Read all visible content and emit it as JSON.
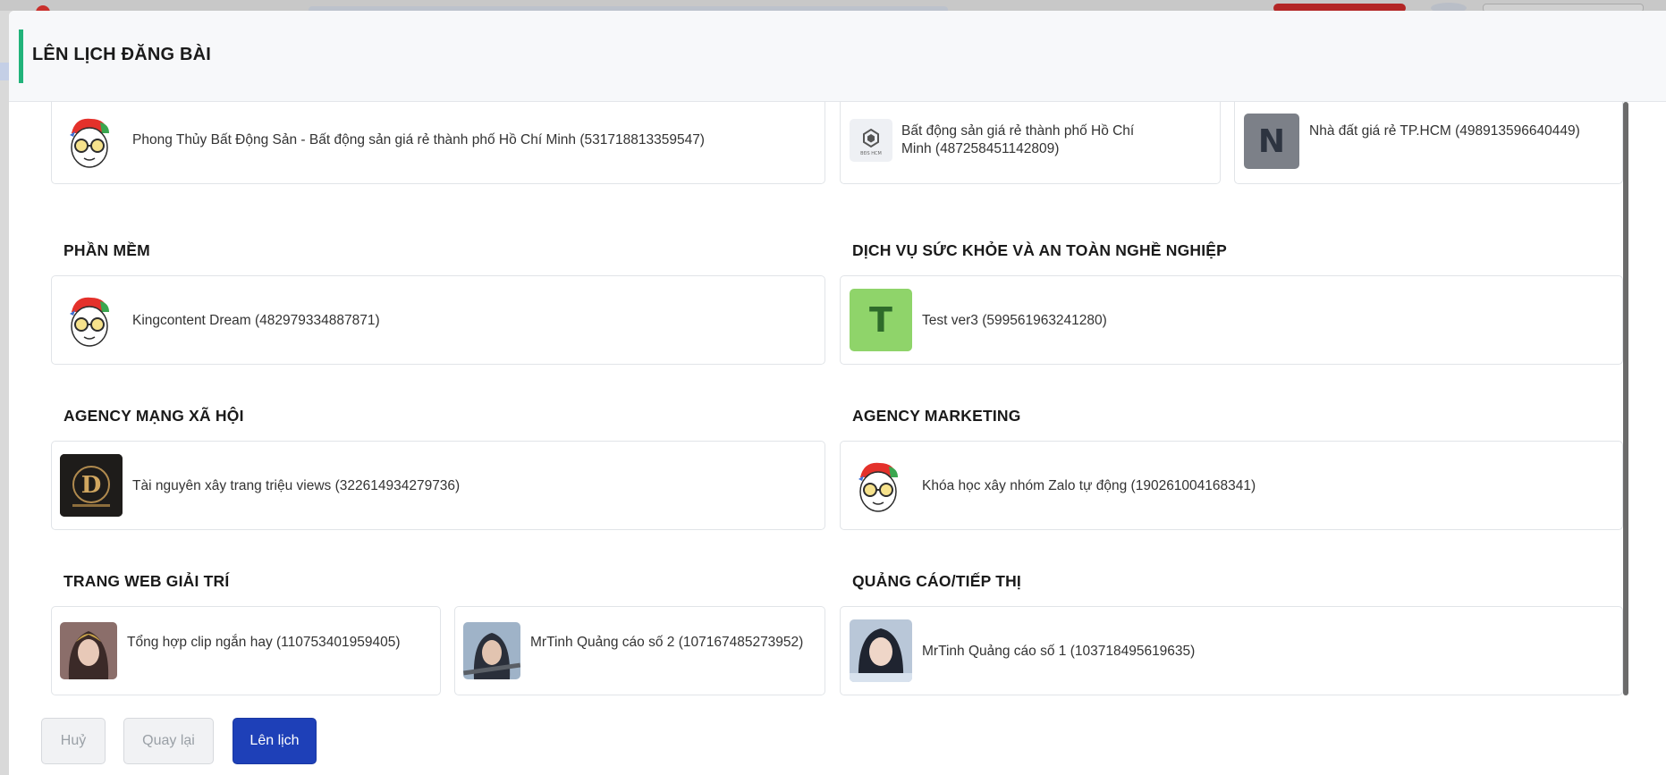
{
  "modal": {
    "title": "LÊN LỊCH ĐĂNG BÀI"
  },
  "top_row": [
    {
      "name": "Phong Thủy Bất Động Sản - Bất động sản giá rẻ thành phố Hồ Chí Minh (531718813359547)",
      "icon": "mascot-avatar-icon"
    },
    {
      "name": "Bất động sản giá rẻ thành phố Hồ Chí Minh (487258451142809)",
      "icon": "logo-avatar-icon",
      "logo_text": "BĐS HCM"
    },
    {
      "name": "Nhà đất giá rẻ TP.HCM (498913596640449)",
      "icon": "letter-avatar-icon",
      "letter": "N"
    }
  ],
  "sections": {
    "phan_mem": {
      "title": "PHẦN MỀM",
      "pages": [
        {
          "name": "Kingcontent Dream (482979334887871)",
          "icon": "mascot-avatar-icon"
        }
      ]
    },
    "dich_vu": {
      "title": "DỊCH VỤ SỨC KHỎE VÀ AN TOÀN NGHỀ NGHIỆP",
      "pages": [
        {
          "name": "Test ver3 (599561963241280)",
          "icon": "letter-avatar-icon",
          "letter": "T"
        }
      ]
    },
    "agency_mxh": {
      "title": "AGENCY MẠNG XÃ HỘI",
      "pages": [
        {
          "name": "Tài nguyên xây trang triệu views (322614934279736)",
          "icon": "d-logo-avatar-icon",
          "letter": "D"
        }
      ]
    },
    "agency_mkt": {
      "title": "AGENCY MARKETING",
      "pages": [
        {
          "name": "Khóa học xây nhóm Zalo tự động (190261004168341)",
          "icon": "mascot-avatar-icon"
        }
      ]
    },
    "giai_tri": {
      "title": "TRANG WEB GIẢI TRÍ",
      "pages": [
        {
          "name": "Tổng hợp clip ngắn hay (110753401959405)",
          "icon": "portrait-avatar-icon"
        },
        {
          "name": "MrTinh Quảng cáo số 2 (107167485273952)",
          "icon": "portrait-avatar-icon"
        }
      ]
    },
    "quang_cao": {
      "title": "QUẢNG CÁO/TIẾP THỊ",
      "pages": [
        {
          "name": "MrTinh Quảng cáo số 1 (103718495619635)",
          "icon": "portrait-avatar-icon"
        }
      ]
    }
  },
  "footer": {
    "cancel_label": "Huỷ",
    "back_label": "Quay lại",
    "schedule_label": "Lên lịch"
  },
  "colors": {
    "accent": "#21b37a",
    "primary": "#1e40b8",
    "avatar_green": "#8fd46a",
    "avatar_gray": "#7c8088"
  }
}
